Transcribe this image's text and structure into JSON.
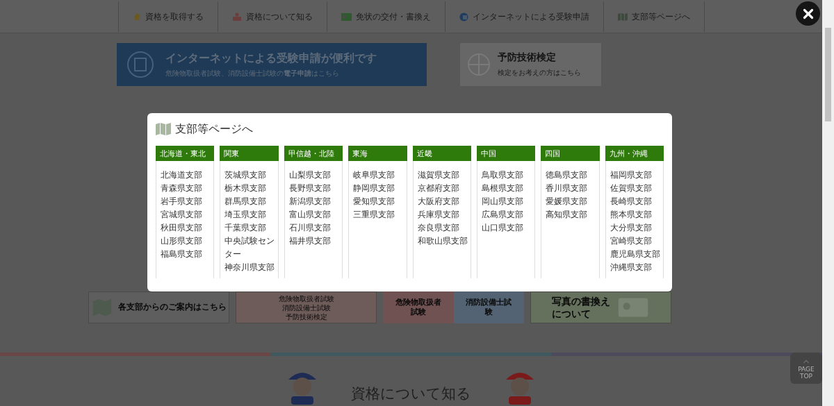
{
  "nav": [
    {
      "label": "資格を取得する"
    },
    {
      "label": "資格について知る"
    },
    {
      "label": "免状の交付・書換え"
    },
    {
      "label": "インターネットによる受験申請"
    },
    {
      "label": "支部等ページへ"
    }
  ],
  "banners": {
    "internet": {
      "title": "インターネットによる受験申請が便利です",
      "subtitle": "危険物取扱者試験、消防設備士試験の**電子申請**はこちら"
    },
    "prevention": {
      "title": "予防技術検定",
      "subtitle": "検定をお考えの方はこちら"
    }
  },
  "cards": [
    {
      "lines": [
        "各支部からのご案内はこちら"
      ]
    },
    {
      "lines": [
        "危険物取扱者試験",
        "消防設備士試験",
        "予防技術検定"
      ]
    },
    {
      "lines": [
        "危険物取扱者試験",
        "消防設備士試験"
      ]
    },
    {
      "lines": [
        "写真の書換え",
        "について"
      ]
    }
  ],
  "section_heading": "資格について知る",
  "page_top": "PAGE TOP",
  "modal": {
    "title": "支部等ページへ",
    "regions": [
      {
        "name": "北海道・東北",
        "branches": [
          "北海道支部",
          "青森県支部",
          "岩手県支部",
          "宮城県支部",
          "秋田県支部",
          "山形県支部",
          "福島県支部"
        ]
      },
      {
        "name": "関東",
        "branches": [
          "茨城県支部",
          "栃木県支部",
          "群馬県支部",
          "埼玉県支部",
          "千葉県支部",
          "中央試験センター",
          "神奈川県支部"
        ]
      },
      {
        "name": "甲信越・北陸",
        "branches": [
          "山梨県支部",
          "長野県支部",
          "新潟県支部",
          "富山県支部",
          "石川県支部",
          "福井県支部"
        ]
      },
      {
        "name": "東海",
        "branches": [
          "岐阜県支部",
          "静岡県支部",
          "愛知県支部",
          "三重県支部"
        ]
      },
      {
        "name": "近畿",
        "branches": [
          "滋賀県支部",
          "京都府支部",
          "大阪府支部",
          "兵庫県支部",
          "奈良県支部",
          "和歌山県支部"
        ]
      },
      {
        "name": "中国",
        "branches": [
          "鳥取県支部",
          "島根県支部",
          "岡山県支部",
          "広島県支部",
          "山口県支部"
        ]
      },
      {
        "name": "四国",
        "branches": [
          "徳島県支部",
          "香川県支部",
          "愛媛県支部",
          "高知県支部"
        ]
      },
      {
        "name": "九州・沖縄",
        "branches": [
          "福岡県支部",
          "佐賀県支部",
          "長崎県支部",
          "熊本県支部",
          "大分県支部",
          "宮崎県支部",
          "鹿児島県支部",
          "沖縄県支部"
        ]
      }
    ]
  }
}
